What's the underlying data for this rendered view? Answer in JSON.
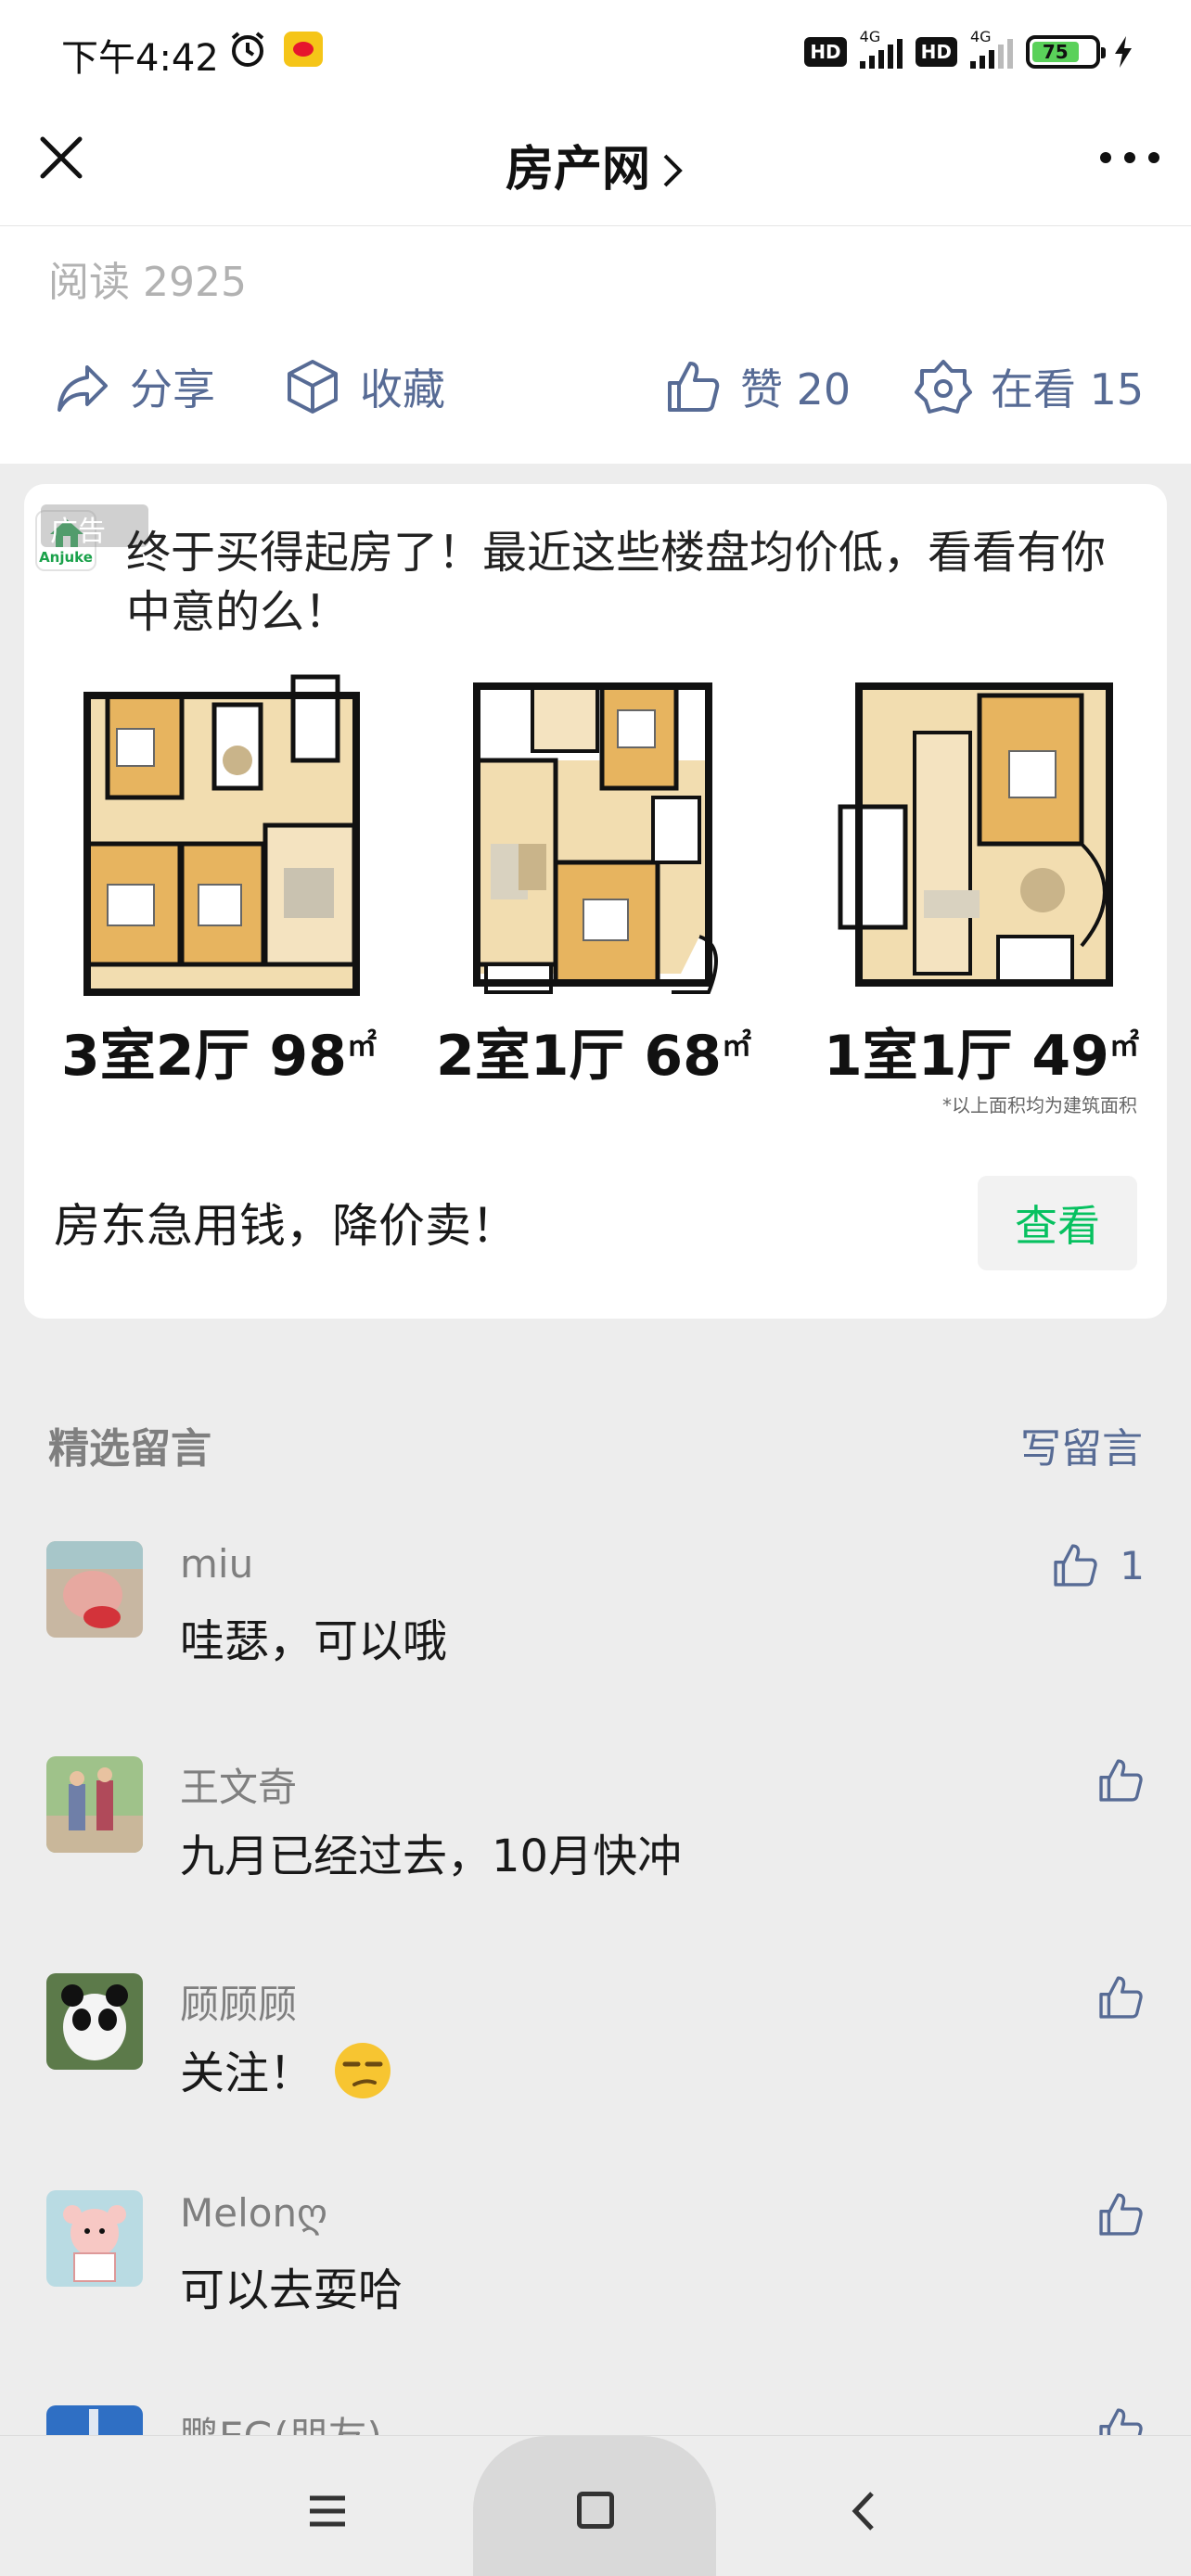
{
  "status_bar": {
    "time": "下午4:42",
    "network": "4G",
    "battery": "75"
  },
  "nav": {
    "title": "房产网"
  },
  "article": {
    "read_count": "阅读 2925",
    "share_label": "分享",
    "favorite_label": "收藏",
    "like_label": "赞 20",
    "watching_label": "在看 15"
  },
  "ad": {
    "tag": "广告",
    "logo_text": "Anjuke",
    "title": "终于买得起房了！最近这些楼盘均价低，看看有你中意的么！",
    "layouts": [
      {
        "label": "3室2厅 98",
        "unit": "㎡"
      },
      {
        "label": "2室1厅 68",
        "unit": "㎡"
      },
      {
        "label": "1室1厅 49",
        "unit": "㎡"
      }
    ],
    "area_note": "*以上面积均为建筑面积",
    "slogan": "房东急用钱，降价卖！",
    "view_button": "查看"
  },
  "comments_section": {
    "header": "精选留言",
    "write_label": "写留言",
    "items": [
      {
        "name": "miu",
        "text": "哇瑟，可以哦",
        "likes": "1"
      },
      {
        "name": "王文奇",
        "text": "九月已经过去，10月快冲",
        "likes": ""
      },
      {
        "name": "顾顾顾",
        "text": "关注！",
        "likes": ""
      },
      {
        "name": "Melonღ",
        "text": "可以去耍哈",
        "likes": ""
      },
      {
        "name": "鹏EG(朋友)",
        "text": "",
        "likes": ""
      }
    ]
  },
  "colors": {
    "link": "#576b95",
    "accent_green": "#07c160"
  }
}
